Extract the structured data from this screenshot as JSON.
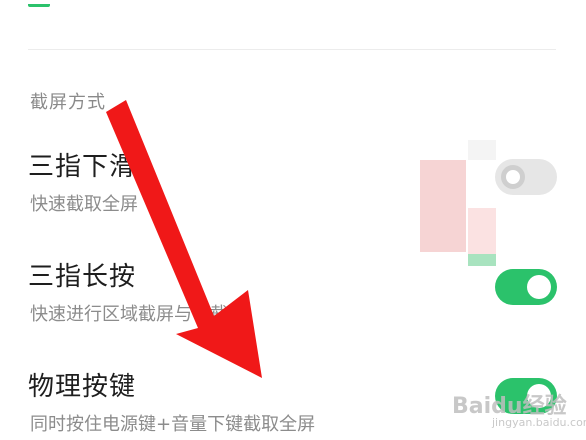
{
  "section": {
    "label": "截屏方式"
  },
  "rows": [
    {
      "title": "三指下滑",
      "subtitle": "快速截取全屏",
      "toggle_on": false
    },
    {
      "title": "三指长按",
      "subtitle": "快速进行区域截屏与长截屏",
      "toggle_on": true
    },
    {
      "title": "物理按键",
      "subtitle": "同时按住电源键+音量下键截取全屏",
      "toggle_on": true
    }
  ],
  "watermark": {
    "text": "Baidu经验",
    "sub": "jingyan.baidu.com"
  },
  "colors": {
    "accent": "#2bc26b",
    "arrow": "#f01818",
    "toggle_off": "#e6e6e6"
  },
  "icons": {
    "annotation": "red-arrow-annotation"
  }
}
